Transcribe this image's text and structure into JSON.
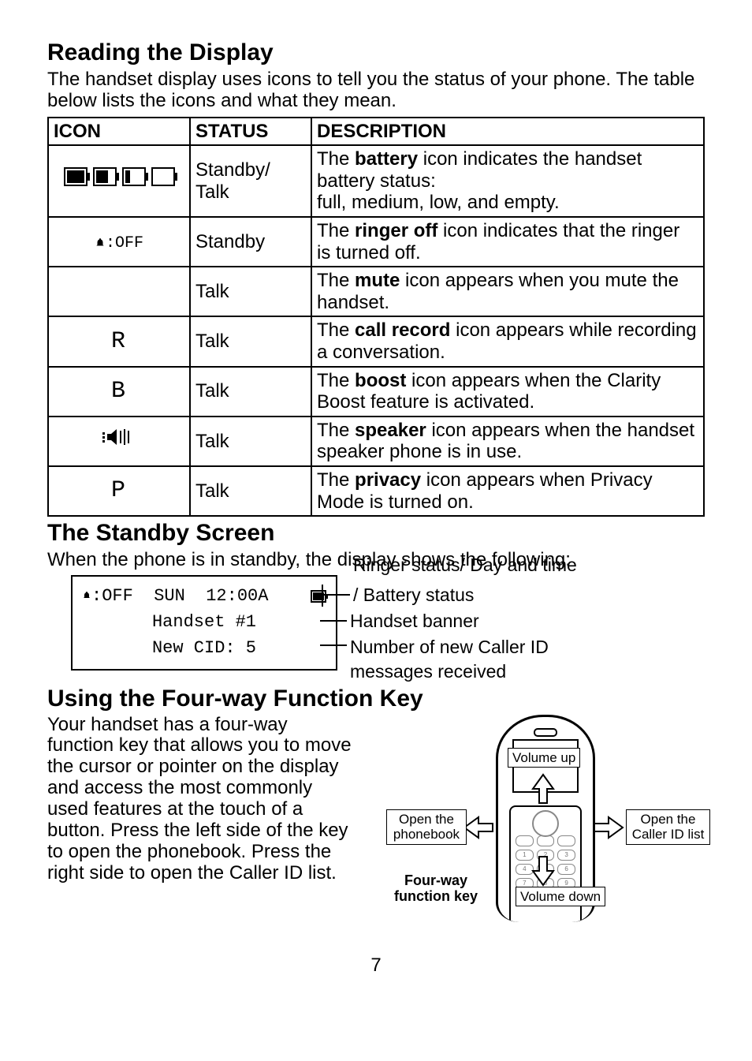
{
  "section1": {
    "heading": "Reading the Display",
    "intro": "The handset display uses icons to tell you the status of your phone. The table below lists the icons and what they mean.",
    "table": {
      "headers": {
        "icon": "ICON",
        "status": "STATUS",
        "desc": "DESCRIPTION"
      },
      "rows": [
        {
          "icon_kind": "battery-levels",
          "status": "Standby/\nTalk",
          "desc_pre": "The ",
          "desc_bold": "battery",
          "desc_post": " icon indicates the handset battery status:\nfull, medium, low, and empty."
        },
        {
          "icon_kind": "ringer-off",
          "status": "Standby",
          "desc_pre": "The ",
          "desc_bold": "ringer off",
          "desc_post": " icon indicates that the ringer is turned off."
        },
        {
          "icon_kind": "blank",
          "status": "Talk",
          "desc_pre": "The ",
          "desc_bold": "mute",
          "desc_post": " icon appears when you mute the handset."
        },
        {
          "icon_kind": "letter",
          "icon_letter": "R",
          "status": "Talk",
          "desc_pre": "The ",
          "desc_bold": "call record",
          "desc_post": " icon appears while recording a conversation."
        },
        {
          "icon_kind": "letter",
          "icon_letter": "B",
          "status": "Talk",
          "desc_pre": "The ",
          "desc_bold": "boost",
          "desc_post": " icon appears when the Clarity Boost feature is activated."
        },
        {
          "icon_kind": "speaker",
          "status": "Talk",
          "desc_pre": "The ",
          "desc_bold": "speaker",
          "desc_post": " icon appears when the handset speaker phone is in use."
        },
        {
          "icon_kind": "letter",
          "icon_letter": "P",
          "status": "Talk",
          "desc_pre": "The ",
          "desc_bold": "privacy",
          "desc_post": " icon appears when Privacy Mode is turned on."
        }
      ]
    }
  },
  "section2": {
    "heading": "The Standby Screen",
    "intro": "When the phone is in standby, the display shows the following:",
    "lcd": {
      "line1_prefix": ":OFF",
      "line1_day": "SUN",
      "line1_time": "12:00A",
      "line2": "Handset #1",
      "line3": "New CID:   5"
    },
    "callouts": {
      "c1": "Ringer status/ Day and time / Battery status",
      "c2": "Handset banner",
      "c3": "Number of new Caller ID messages received"
    }
  },
  "section3": {
    "heading": "Using the Four-way Function Key",
    "body": "Your handset has a four-way function key that allows you to move the cursor or pointer on the display and access the most commonly used features at the touch of a button. Press the left side of the key to open the phonebook. Press the right side to open the Caller ID list.",
    "labels": {
      "volume_up": "Volume up",
      "volume_down": "Volume down",
      "open_phonebook": "Open the phonebook",
      "open_cid": "Open the Caller ID list",
      "caption": "Four-way function key"
    }
  },
  "page_number": "7"
}
